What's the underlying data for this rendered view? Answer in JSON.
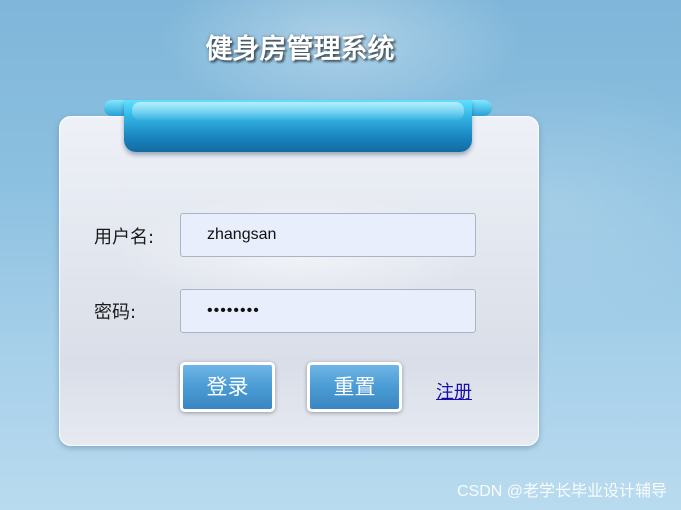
{
  "title": "健身房管理系统",
  "form": {
    "username_label": "用户名:",
    "username_value": "zhangsan",
    "password_label": "密码:",
    "password_value": "••••••••"
  },
  "buttons": {
    "login": "登录",
    "reset": "重置",
    "register": "注册"
  },
  "watermark": "CSDN @老学长毕业设计辅导",
  "colors": {
    "background": "#8cc0e0",
    "ribbon": "#1a86c2",
    "button": "#4a9bd4",
    "link": "#1a0dab"
  }
}
